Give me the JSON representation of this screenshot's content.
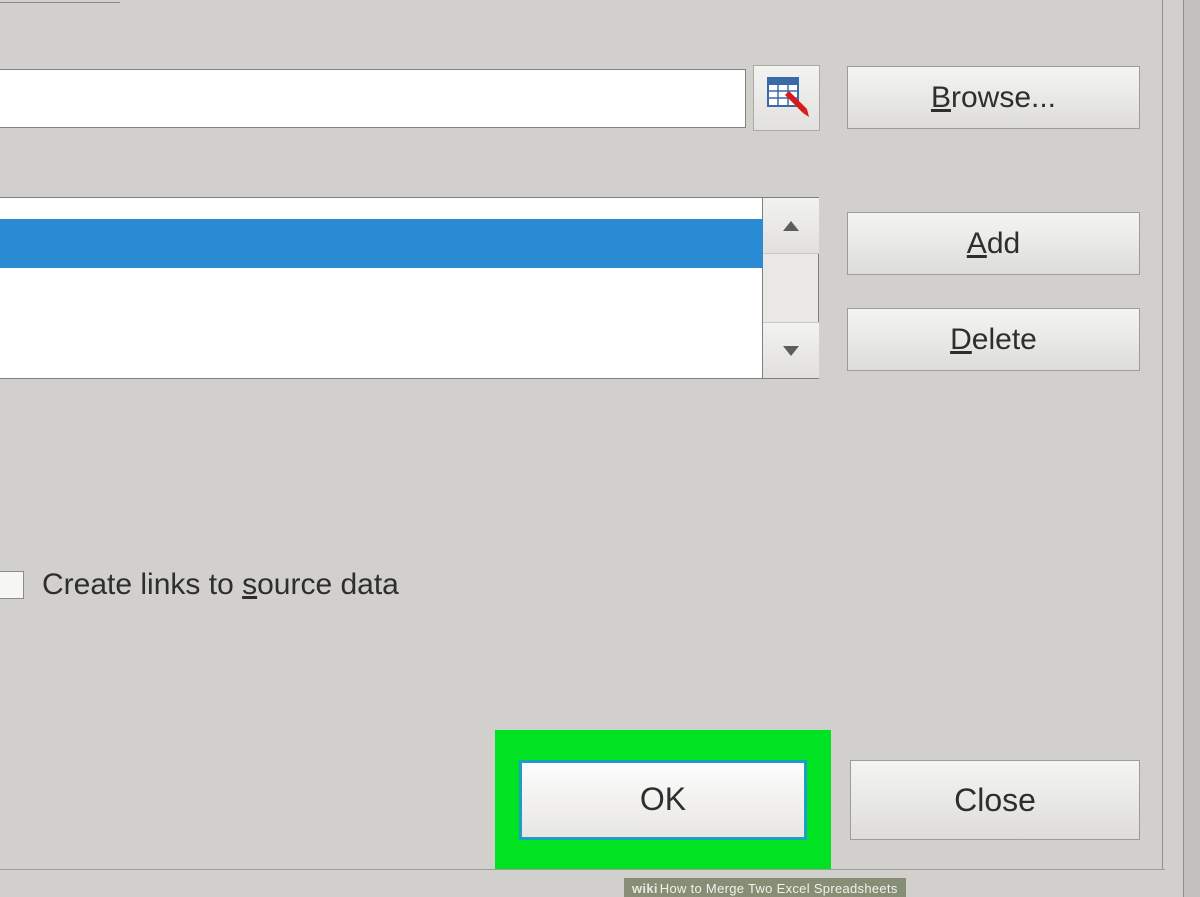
{
  "buttons": {
    "browse": "Browse...",
    "add": "Add",
    "delete": "Delete",
    "ok": "OK",
    "close": "Close"
  },
  "browse_mnemonic": "B",
  "add_mnemonic": "A",
  "delete_mnemonic": "D",
  "checkbox": {
    "label_pre": "Create links to ",
    "mnemonic": "s",
    "label_post": "ource data"
  },
  "watermark": {
    "brand": "wiki",
    "text": "How to Merge Two Excel Spreadsheets"
  }
}
